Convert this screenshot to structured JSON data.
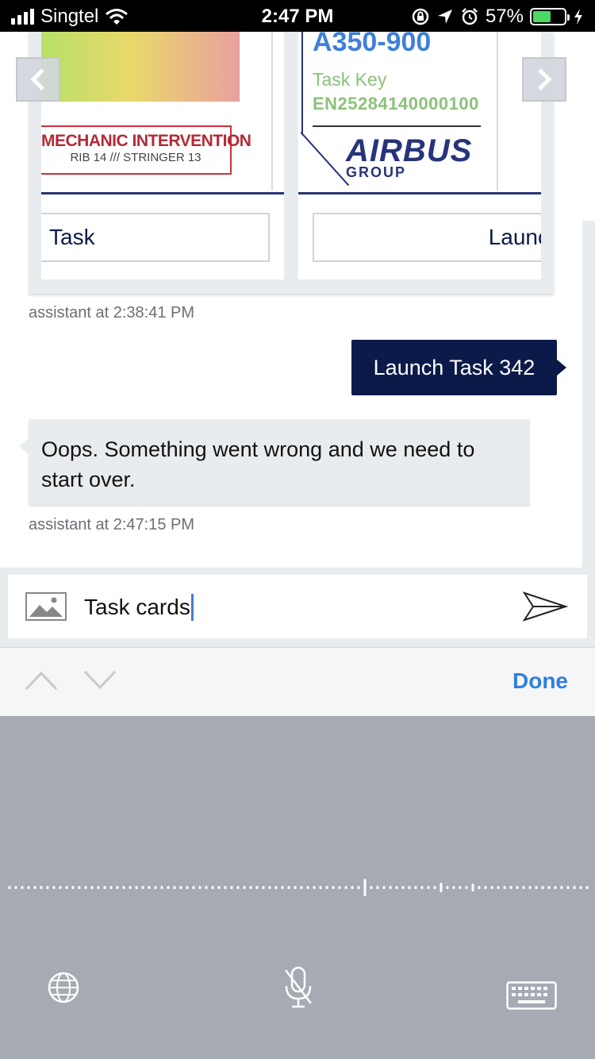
{
  "status_bar": {
    "carrier": "Singtel",
    "time": "2:47 PM",
    "battery_percent": "57%",
    "battery_level": 0.57,
    "battery_color": "#4cd964"
  },
  "carousel": {
    "cards": [
      {
        "image_text_line1": "MECHANIC INTERVENTION",
        "image_text_line2": "RIB 14 /// STRINGER 13",
        "button_label": "Task"
      },
      {
        "aircraft_model": "A350-900",
        "task_key_label": "Task Key",
        "task_key_value": "EN25284140000100",
        "logo_text": "AIRBUS",
        "logo_subtext": "GROUP",
        "button_label": "Launc"
      }
    ]
  },
  "messages": [
    {
      "timestamp": "assistant at 2:38:41 PM"
    },
    {
      "sender": "user",
      "text": "Launch Task 342"
    },
    {
      "sender": "assistant",
      "text": "Oops. Something went wrong and we need to start over.",
      "timestamp": "assistant at 2:47:15 PM"
    }
  ],
  "composer": {
    "input_value": "Task cards",
    "attach_icon": "image-icon",
    "send_icon": "send-icon"
  },
  "keyboard_toolbar": {
    "done_label": "Done"
  },
  "dictation": {
    "icons": [
      "globe-icon",
      "microphone-icon",
      "keyboard-icon"
    ]
  },
  "colors": {
    "user_bubble": "#0c1a4a",
    "bot_bubble": "#e9ecef",
    "accent": "#2f7fe0"
  }
}
